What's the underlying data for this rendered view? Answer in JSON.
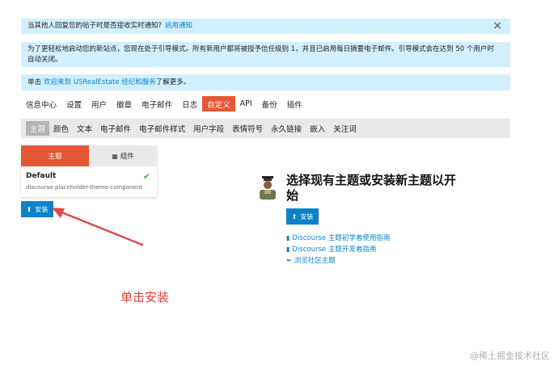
{
  "notices": {
    "reply_notification": {
      "text": "当其他人回复您的帖子时是否接收实时通知?",
      "link": "启用通知"
    },
    "bootstrap": "为了更轻松地启动您的新站点，您现在处于引导模式。所有新用户都将被授予信任级别 1，并且已启用每日摘要电子邮件。引导模式会在达到 50 个用户时自动关闭。",
    "welcome": {
      "prefix": "单击",
      "link": "欢迎来到 USRealEstate 经纪和服务",
      "suffix": "了解更多。"
    }
  },
  "top_nav": [
    "信息中心",
    "设置",
    "用户",
    "徽章",
    "电子邮件",
    "日志",
    "自定义",
    "API",
    "备份",
    "插件"
  ],
  "top_nav_active": "自定义",
  "sub_nav": [
    "主题",
    "颜色",
    "文本",
    "电子邮件",
    "电子邮件样式",
    "用户字段",
    "表情符号",
    "永久链接",
    "嵌入",
    "关注词"
  ],
  "sub_nav_active": "主题",
  "themes_panel": {
    "tab_themes": "主题",
    "tab_components": "组件",
    "theme_name": "Default",
    "theme_component": "discourse-placeholder-theme-component"
  },
  "install_label": "安装",
  "empty_state": {
    "heading": "选择现有主题或安装新主题以开始",
    "install_label": "安装",
    "links": [
      "Discourse 主题初学者使用指南",
      "Discourse 主题开发者指南",
      "浏览社区主题"
    ]
  },
  "annotation": "单击安装",
  "watermark": "@稀土掘金技术社区",
  "colors": {
    "accent": "#e45735",
    "primary_button": "#0a83c9",
    "notice_bg": "#d1f0ff",
    "annotation": "#e03a3a"
  }
}
